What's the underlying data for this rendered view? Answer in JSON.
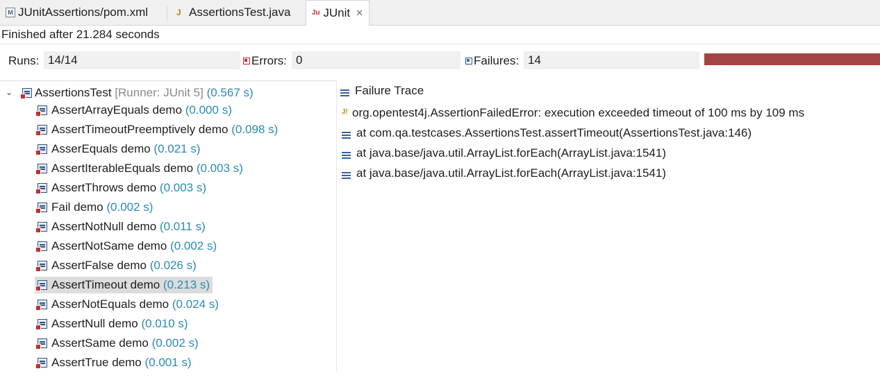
{
  "tabs": [
    {
      "label": "JUnitAssertions/pom.xml",
      "icon": "maven-pom-icon",
      "active": false
    },
    {
      "label": "AssertionsTest.java",
      "icon": "java-file-icon",
      "active": false
    },
    {
      "label": "JUnit",
      "icon": "junit-icon",
      "active": true,
      "close": "✕"
    }
  ],
  "status": "Finished after 21.284 seconds",
  "counters": {
    "runs_label": "Runs:",
    "runs_value": "14/14",
    "errors_label": "Errors:",
    "errors_value": "0",
    "failures_label": "Failures:",
    "failures_value": "14"
  },
  "progress": {
    "fraction": 1.0,
    "color": "#a34343"
  },
  "tree": {
    "root": {
      "name": "AssertionsTest",
      "runner": "[Runner: JUnit 5]",
      "time": "(0.567 s)"
    },
    "items": [
      {
        "name": "AssertArrayEquals demo",
        "time": "(0.000 s)"
      },
      {
        "name": "AssertTimeoutPreemptively demo",
        "time": "(0.098 s)"
      },
      {
        "name": "AsserEquals demo",
        "time": "(0.021 s)"
      },
      {
        "name": "AssertIterableEquals demo",
        "time": "(0.003 s)"
      },
      {
        "name": "AssertThrows demo",
        "time": "(0.003 s)"
      },
      {
        "name": "Fail demo",
        "time": "(0.002 s)"
      },
      {
        "name": "AssertNotNull demo",
        "time": "(0.011 s)"
      },
      {
        "name": "AssertNotSame demo",
        "time": "(0.002 s)"
      },
      {
        "name": "AssertFalse demo",
        "time": "(0.026 s)"
      },
      {
        "name": "AssertTimeout demo",
        "time": "(0.213 s)",
        "selected": true
      },
      {
        "name": "AsserNotEquals demo",
        "time": "(0.024 s)"
      },
      {
        "name": "AssertNull demo",
        "time": "(0.010 s)"
      },
      {
        "name": "AssertSame demo",
        "time": "(0.002 s)"
      },
      {
        "name": "AssertTrue demo",
        "time": "(0.001 s)"
      }
    ]
  },
  "trace": {
    "header": "Failure Trace",
    "lines": [
      {
        "text": "org.opentest4j.AssertionFailedError: execution exceeded timeout of 100 ms by 109 ms",
        "icon": "exception-icon"
      },
      {
        "text": "at com.qa.testcases.AssertionsTest.assertTimeout(AssertionsTest.java:146)",
        "icon": "stack-frame-icon"
      },
      {
        "text": "at java.base/java.util.ArrayList.forEach(ArrayList.java:1541)",
        "icon": "stack-frame-icon"
      },
      {
        "text": "at java.base/java.util.ArrayList.forEach(ArrayList.java:1541)",
        "icon": "stack-frame-icon"
      }
    ]
  }
}
